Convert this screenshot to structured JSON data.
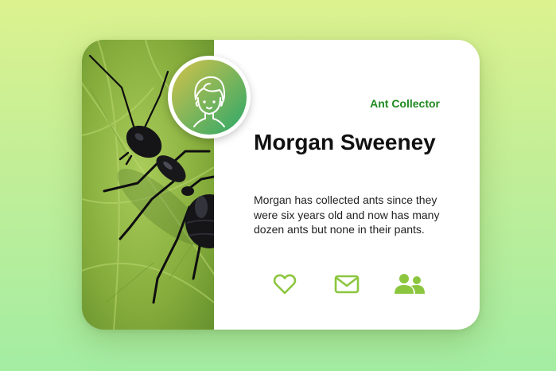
{
  "profile": {
    "role_badge": "Ant Collector",
    "name": "Morgan Sweeney",
    "bio": "Morgan has collected ants since they were six years old and now has many dozen ants but none in their pants."
  },
  "photo": {
    "subject": "black ant on a green leaf"
  },
  "actions": [
    {
      "icon": "heart-icon"
    },
    {
      "icon": "envelope-icon"
    },
    {
      "icon": "users-icon"
    }
  ],
  "colors": {
    "accent": "#8cc63f",
    "badge": "#1f8a1f",
    "avatar_gradient_start": "#d4c24a",
    "avatar_gradient_end": "#2aa86a"
  }
}
